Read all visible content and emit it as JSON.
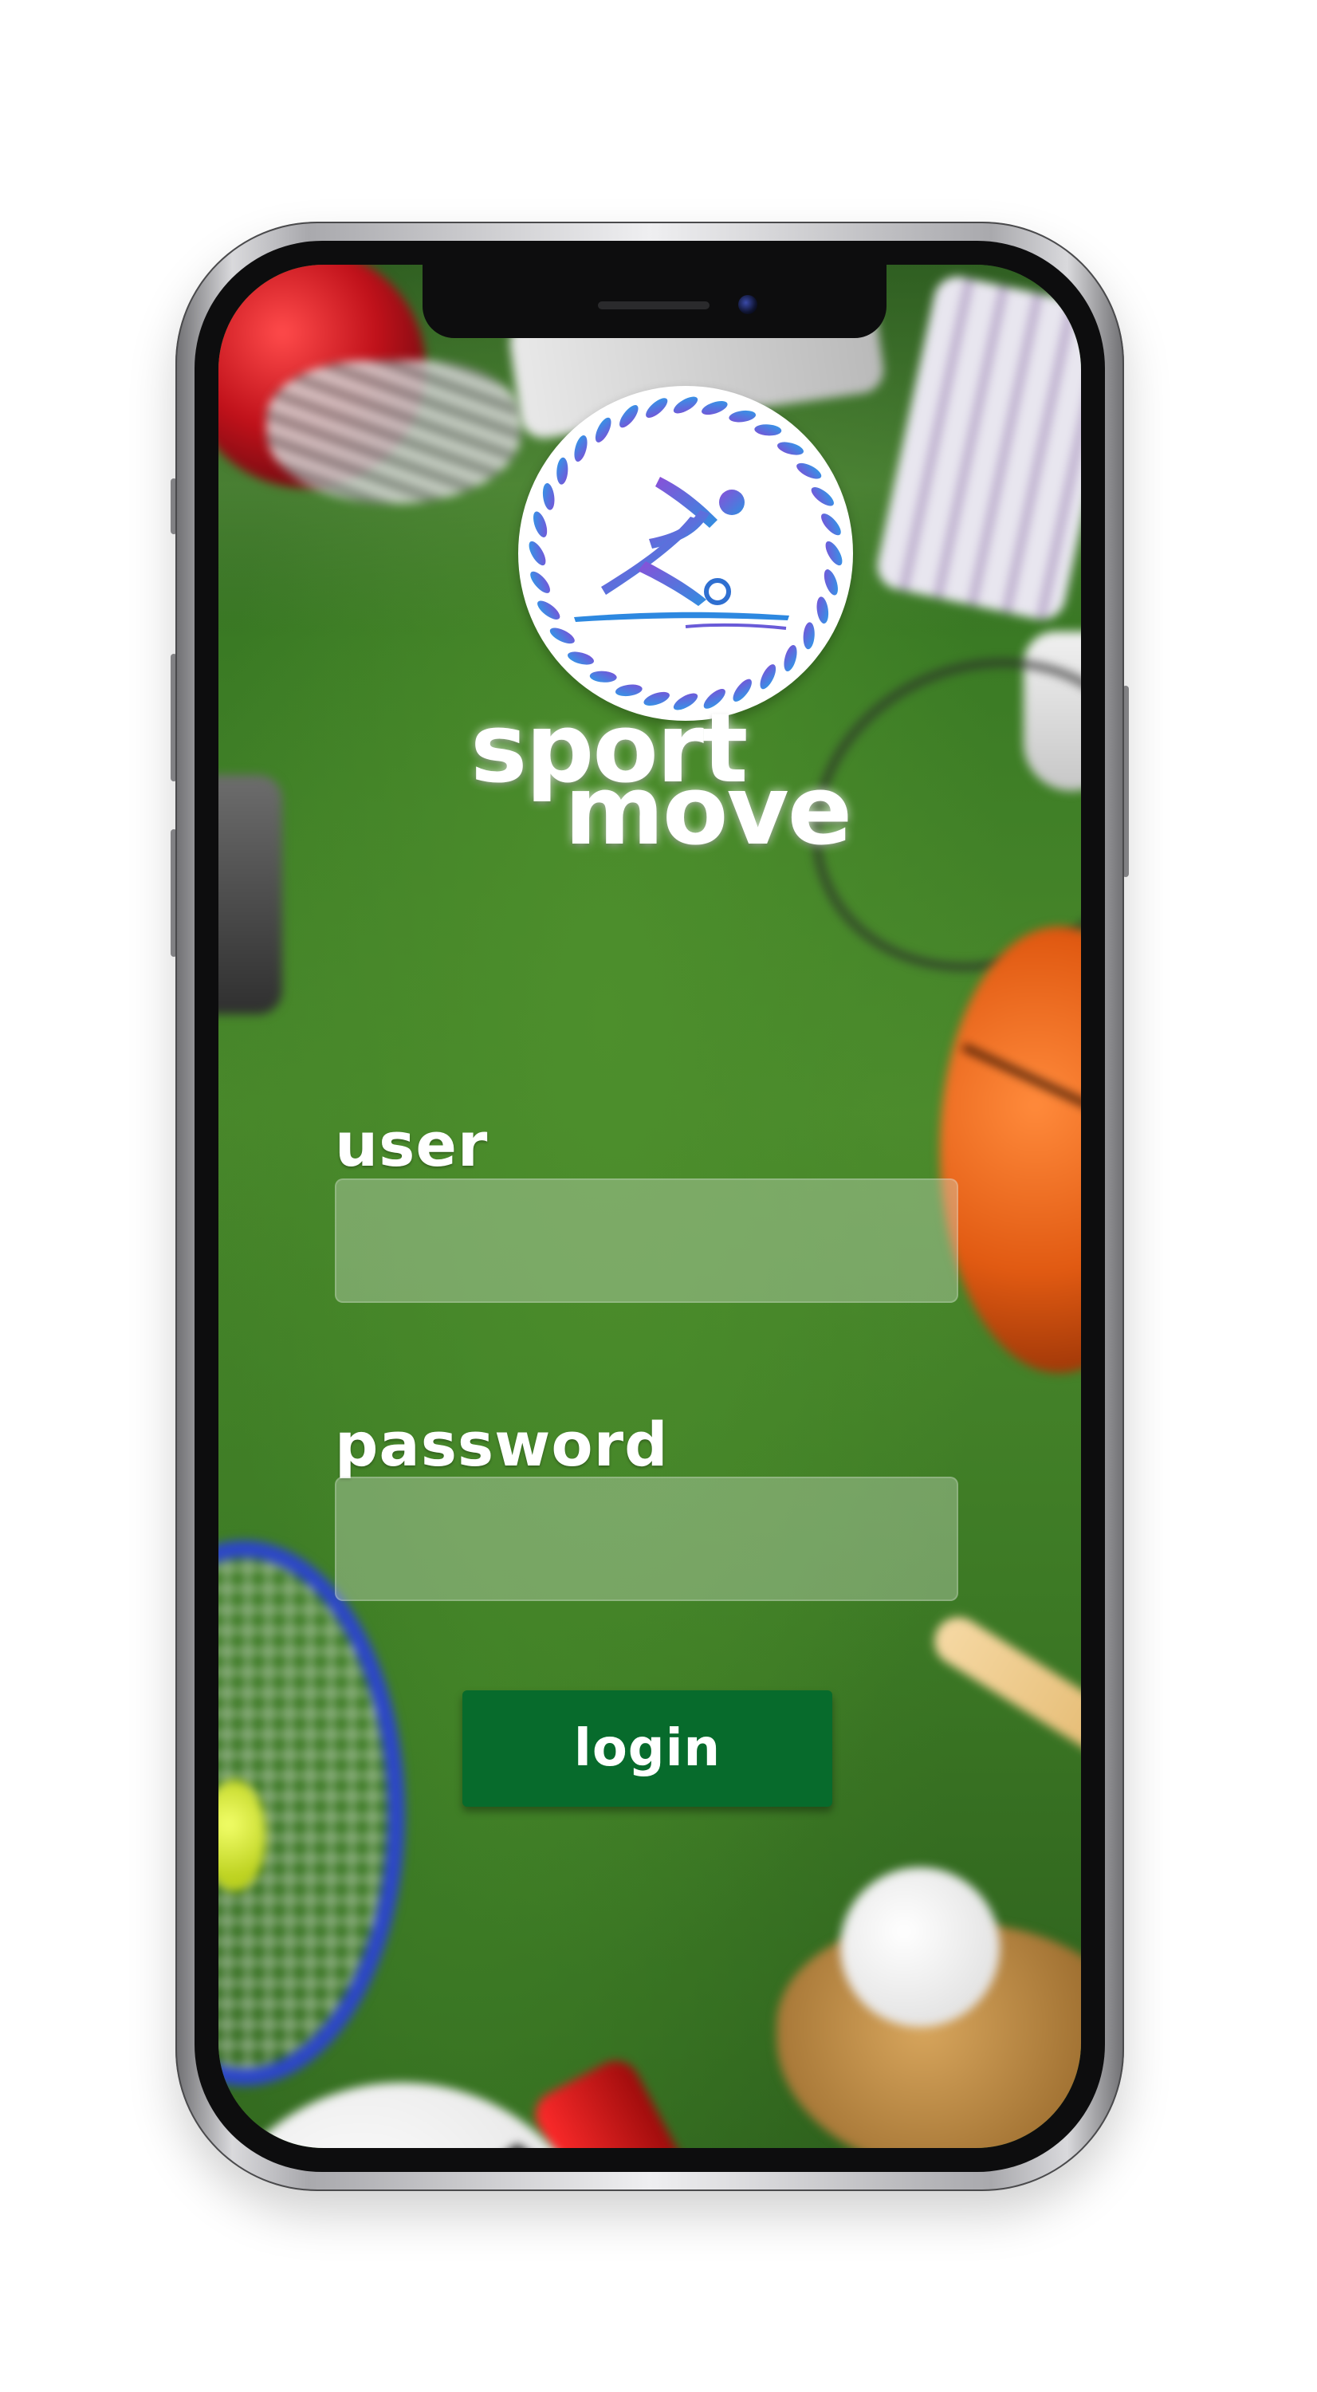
{
  "app": {
    "brand_line1": "sport",
    "brand_line2": "move",
    "logo_icon": "athlete-ball-icon"
  },
  "login_form": {
    "user_label": "user",
    "user_value": "",
    "password_label": "password",
    "password_value": "",
    "login_button_label": "login"
  },
  "colors": {
    "accent_green": "#076b2c",
    "logo_blue": "#2d88e0",
    "logo_purple": "#7b4fd6"
  }
}
